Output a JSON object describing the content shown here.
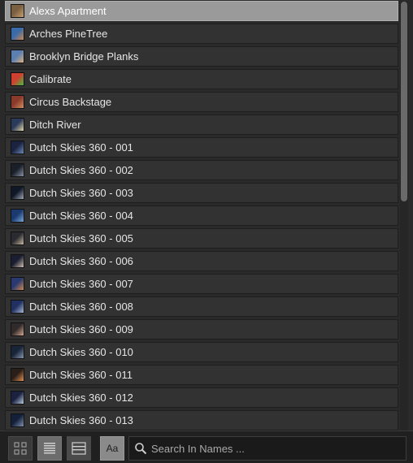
{
  "list": {
    "items": [
      {
        "label": "Alexs Apartment",
        "selected": true,
        "thumb": [
          "#7a6040",
          "#c9a070"
        ]
      },
      {
        "label": "Arches PineTree",
        "thumb": [
          "#3a6aa8",
          "#d08a50"
        ]
      },
      {
        "label": "Brooklyn Bridge Planks",
        "thumb": [
          "#5a7fb0",
          "#e0b080"
        ]
      },
      {
        "label": "Calibrate",
        "thumb": [
          "#d04030",
          "#3fbf3f"
        ]
      },
      {
        "label": "Circus Backstage",
        "thumb": [
          "#8a3a2a",
          "#d09060"
        ]
      },
      {
        "label": "Ditch River",
        "thumb": [
          "#2a3a5a",
          "#e8d8a8"
        ]
      },
      {
        "label": "Dutch Skies 360 - 001",
        "thumb": [
          "#1a2440",
          "#6a88b8"
        ]
      },
      {
        "label": "Dutch Skies 360 - 002",
        "thumb": [
          "#1a1f2a",
          "#8a94a8"
        ]
      },
      {
        "label": "Dutch Skies 360 - 003",
        "thumb": [
          "#101828",
          "#a0a8b8"
        ]
      },
      {
        "label": "Dutch Skies 360 - 004",
        "thumb": [
          "#1a3a70",
          "#7aa6d8"
        ]
      },
      {
        "label": "Dutch Skies 360 - 005",
        "thumb": [
          "#2a2a30",
          "#c8b8a0"
        ]
      },
      {
        "label": "Dutch Skies 360 - 006",
        "thumb": [
          "#1a1e30",
          "#d0c0b0"
        ]
      },
      {
        "label": "Dutch Skies 360 - 007",
        "thumb": [
          "#2a3a70",
          "#d08850"
        ]
      },
      {
        "label": "Dutch Skies 360 - 008",
        "thumb": [
          "#203060",
          "#a8b8d8"
        ]
      },
      {
        "label": "Dutch Skies 360 - 009",
        "thumb": [
          "#302a2a",
          "#d8a890"
        ]
      },
      {
        "label": "Dutch Skies 360 - 010",
        "thumb": [
          "#182438",
          "#8898b0"
        ]
      },
      {
        "label": "Dutch Skies 360 - 011",
        "thumb": [
          "#2a1e18",
          "#e09050"
        ]
      },
      {
        "label": "Dutch Skies 360 - 012",
        "thumb": [
          "#1a2240",
          "#b8c8e0"
        ]
      },
      {
        "label": "Dutch Skies 360 - 013",
        "thumb": [
          "#14203a",
          "#8090b0"
        ]
      }
    ]
  },
  "toolbar": {
    "grid_icon": "grid-view-icon",
    "list_icon": "list-view-icon",
    "detail_icon": "detail-view-icon",
    "font_label": "Aa",
    "search_placeholder": "Search In Names ..."
  },
  "colors": {
    "background": "#2a2a2a",
    "row": "#323232",
    "selected_row": "#9a9a9a",
    "text": "#e6e6e6"
  }
}
